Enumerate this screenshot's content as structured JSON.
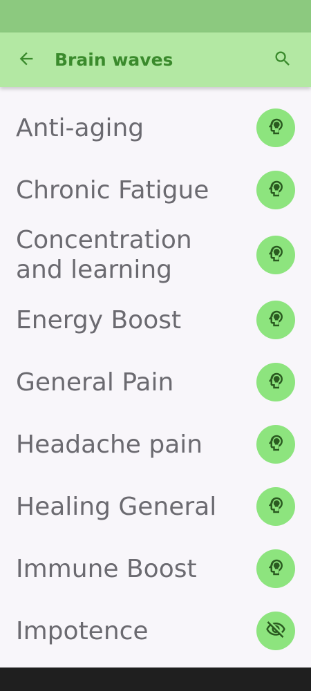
{
  "app_bar": {
    "title": "Brain waves",
    "back_icon": "arrow-left-icon",
    "search_icon": "search-icon"
  },
  "colors": {
    "status_bar": "#8cc97f",
    "app_bar": "#b3e8a3",
    "title": "#3a8a2c",
    "fab": "#8de47e",
    "item_text": "#6b6a70",
    "background": "#f8f6fa",
    "nav_bar": "#1f1f1f"
  },
  "items": [
    {
      "label": "Anti-aging",
      "icon": "head-brain-icon"
    },
    {
      "label": "Chronic Fatigue",
      "icon": "head-brain-icon"
    },
    {
      "label": "Concentration and learning",
      "icon": "head-brain-icon"
    },
    {
      "label": "Energy Boost",
      "icon": "head-brain-icon"
    },
    {
      "label": "General Pain",
      "icon": "head-brain-icon"
    },
    {
      "label": "Headache pain",
      "icon": "head-brain-icon"
    },
    {
      "label": "Healing General",
      "icon": "head-brain-icon"
    },
    {
      "label": "Immune Boost",
      "icon": "head-brain-icon"
    },
    {
      "label": "Impotence",
      "icon": "eye-off-icon"
    }
  ]
}
